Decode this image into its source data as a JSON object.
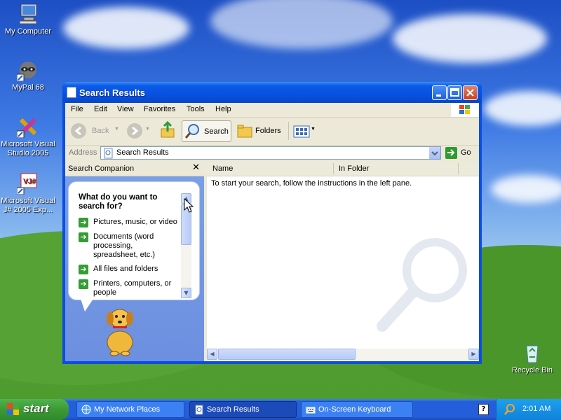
{
  "desktop": {
    "icons": [
      {
        "label": "My Computer"
      },
      {
        "label": "MyPal 68"
      },
      {
        "label": "Microsoft Visual Studio 2005"
      },
      {
        "label": "Microsoft Visual J# 2005 Exp..."
      },
      {
        "label": "Recycle Bin"
      }
    ]
  },
  "window": {
    "title": "Search Results",
    "menu": [
      "File",
      "Edit",
      "View",
      "Favorites",
      "Tools",
      "Help"
    ],
    "toolbar": {
      "back_label": "Back",
      "search_label": "Search",
      "folders_label": "Folders"
    },
    "address": {
      "label": "Address",
      "value": "Search Results",
      "go_label": "Go"
    },
    "left_pane": {
      "header": "Search Companion",
      "question": "What do you want to search for?",
      "options": [
        "Pictures, music, or video",
        "Documents (word processing, spreadsheet, etc.)",
        "All files and folders",
        "Printers, computers, or people"
      ]
    },
    "right_pane": {
      "columns": [
        "Name",
        "In Folder"
      ],
      "message": "To start your search, follow the instructions in the left pane."
    }
  },
  "taskbar": {
    "start_label": "start",
    "tasks": [
      {
        "label": "My Network Places"
      },
      {
        "label": "Search Results"
      },
      {
        "label": "On-Screen Keyboard"
      }
    ],
    "clock": "2:01 AM"
  },
  "colors": {
    "titlebar": "#0a5be8",
    "taskbar": "#245edb",
    "start_button": "#3c9a34",
    "window_face": "#ece9d8"
  }
}
